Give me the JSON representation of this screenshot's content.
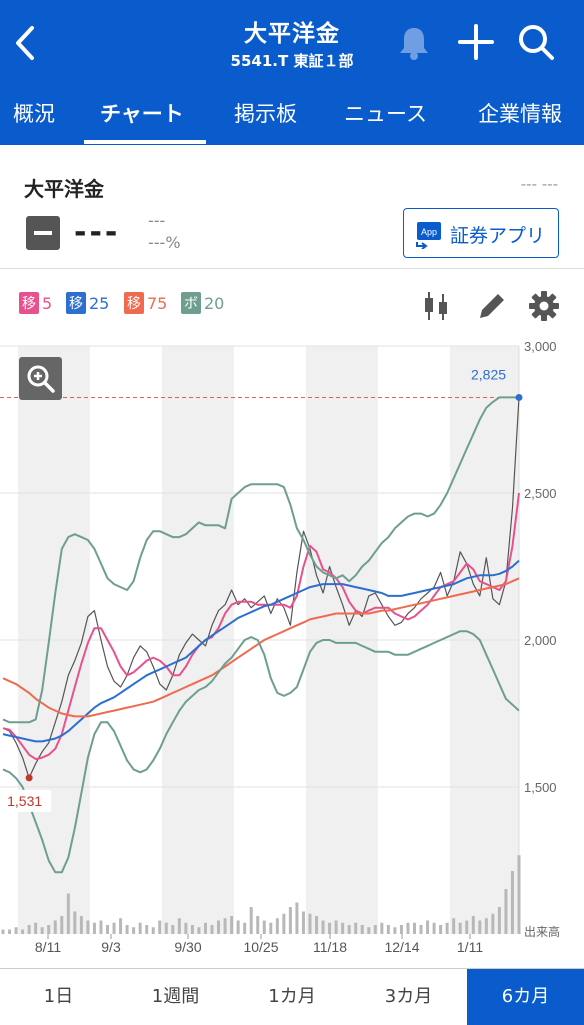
{
  "header": {
    "title": "大平洋金",
    "subtitle": "5541.T 東証１部",
    "tabs": [
      "概況",
      "チャート",
      "掲示板",
      "ニュース",
      "企業情報"
    ]
  },
  "stock": {
    "name": "大平洋金",
    "time": "--- ---",
    "price": "---",
    "change": "---",
    "change_pct": "---%",
    "app_button": "証券アプリ",
    "app_icon_text": "App"
  },
  "legend": [
    {
      "chip": "移",
      "value": "5",
      "color": "#e8508e"
    },
    {
      "chip": "移",
      "value": "25",
      "color": "#2c6fce"
    },
    {
      "chip": "移",
      "value": "75",
      "color": "#ef6a4e"
    },
    {
      "chip": "ボ",
      "value": "20",
      "color": "#6e9e90"
    }
  ],
  "chart_data": {
    "type": "line",
    "x_tick_labels": [
      "8/11",
      "9/3",
      "9/30",
      "10/25",
      "11/18",
      "12/14",
      "1/11"
    ],
    "y_tick_labels": [
      "3,000",
      "2,500",
      "2,000",
      "1,500"
    ],
    "ylim": [
      1000,
      3000
    ],
    "volume_label": "出来高",
    "annotations": {
      "high": "2,825",
      "low": "1,531"
    },
    "series": [
      {
        "values": [
          1700,
          1690,
          1650,
          1600,
          1531,
          1580,
          1620,
          1650,
          1720,
          1790,
          1880,
          1930,
          1990,
          2080,
          2100,
          2000,
          1910,
          1860,
          1840,
          1880,
          1940,
          1980,
          1960,
          1910,
          1850,
          1830,
          1880,
          1950,
          1990,
          2020,
          2000,
          1980,
          2050,
          2100,
          2120,
          2170,
          2120,
          2140,
          2110,
          2130,
          2150,
          2090,
          2140,
          2110,
          2050,
          2230,
          2370,
          2310,
          2220,
          2160,
          2250,
          2180,
          2120,
          2050,
          2100,
          2080,
          2150,
          2160,
          2120,
          2080,
          2050,
          2060,
          2090,
          2110,
          2140,
          2160,
          2180,
          2230,
          2150,
          2200,
          2300,
          2260,
          2190,
          2150,
          2280,
          2140,
          2120,
          2200,
          2450,
          2825
        ]
      },
      {
        "name": "5",
        "values": [
          1700,
          1695,
          1670,
          1640,
          1610,
          1595,
          1600,
          1610,
          1630,
          1680,
          1760,
          1840,
          1920,
          1990,
          2040,
          2040,
          2000,
          1960,
          1910,
          1880,
          1890,
          1910,
          1930,
          1940,
          1930,
          1910,
          1880,
          1880,
          1910,
          1950,
          1980,
          2000,
          2010,
          2040,
          2090,
          2120,
          2130,
          2130,
          2130,
          2120,
          2120,
          2120,
          2120,
          2120,
          2110,
          2150,
          2250,
          2320,
          2300,
          2240,
          2230,
          2210,
          2180,
          2130,
          2100,
          2090,
          2100,
          2110,
          2110,
          2110,
          2090,
          2080,
          2070,
          2080,
          2100,
          2120,
          2150,
          2180,
          2190,
          2200,
          2230,
          2260,
          2240,
          2200,
          2190,
          2180,
          2170,
          2200,
          2320,
          2500
        ]
      },
      {
        "name": "25",
        "values": [
          1680,
          1675,
          1670,
          1665,
          1660,
          1655,
          1655,
          1660,
          1665,
          1675,
          1690,
          1710,
          1730,
          1750,
          1770,
          1785,
          1795,
          1805,
          1820,
          1835,
          1850,
          1865,
          1880,
          1890,
          1900,
          1910,
          1920,
          1930,
          1940,
          1960,
          1980,
          2000,
          2015,
          2030,
          2045,
          2060,
          2075,
          2085,
          2095,
          2105,
          2115,
          2120,
          2130,
          2140,
          2150,
          2160,
          2170,
          2180,
          2185,
          2190,
          2190,
          2190,
          2190,
          2185,
          2180,
          2175,
          2170,
          2165,
          2160,
          2150,
          2150,
          2150,
          2155,
          2160,
          2165,
          2170,
          2175,
          2180,
          2185,
          2190,
          2200,
          2210,
          2215,
          2220,
          2220,
          2220,
          2225,
          2235,
          2250,
          2270
        ]
      },
      {
        "name": "75",
        "values": [
          1870,
          1860,
          1850,
          1835,
          1820,
          1800,
          1785,
          1770,
          1760,
          1750,
          1745,
          1740,
          1740,
          1740,
          1745,
          1750,
          1755,
          1760,
          1765,
          1770,
          1775,
          1780,
          1785,
          1790,
          1800,
          1810,
          1820,
          1830,
          1840,
          1850,
          1860,
          1870,
          1880,
          1895,
          1910,
          1925,
          1940,
          1955,
          1970,
          1985,
          2000,
          2010,
          2020,
          2030,
          2040,
          2050,
          2060,
          2070,
          2075,
          2080,
          2085,
          2090,
          2090,
          2090,
          2090,
          2090,
          2090,
          2095,
          2100,
          2100,
          2105,
          2110,
          2115,
          2120,
          2125,
          2130,
          2135,
          2140,
          2145,
          2150,
          2155,
          2160,
          2165,
          2170,
          2175,
          2180,
          2185,
          2190,
          2200,
          2210
        ]
      },
      {
        "name": "20",
        "values": [
          1730,
          1720,
          1720,
          1720,
          1720,
          1730,
          1830,
          1990,
          2160,
          2310,
          2350,
          2360,
          2350,
          2340,
          2310,
          2260,
          2210,
          2190,
          2180,
          2170,
          2200,
          2280,
          2340,
          2370,
          2370,
          2360,
          2350,
          2350,
          2360,
          2380,
          2400,
          2390,
          2390,
          2390,
          2380,
          2480,
          2500,
          2520,
          2530,
          2530,
          2530,
          2530,
          2530,
          2520,
          2460,
          2380,
          2340,
          2290,
          2250,
          2230,
          2220,
          2210,
          2220,
          2200,
          2220,
          2250,
          2270,
          2300,
          2330,
          2350,
          2380,
          2400,
          2420,
          2430,
          2430,
          2420,
          2430,
          2460,
          2500,
          2550,
          2600,
          2650,
          2700,
          2750,
          2790,
          2810,
          2825,
          2825,
          2825,
          2825
        ]
      },
      {
        "name": "20",
        "values": [
          1560,
          1550,
          1530,
          1500,
          1440,
          1380,
          1320,
          1250,
          1210,
          1210,
          1260,
          1360,
          1480,
          1600,
          1680,
          1720,
          1720,
          1690,
          1640,
          1590,
          1560,
          1550,
          1560,
          1590,
          1630,
          1680,
          1720,
          1760,
          1790,
          1810,
          1830,
          1840,
          1860,
          1890,
          1920,
          1940,
          1970,
          2000,
          2010,
          2000,
          1950,
          1870,
          1820,
          1810,
          1820,
          1840,
          1900,
          1960,
          1990,
          2000,
          2000,
          1990,
          1990,
          1990,
          1990,
          1980,
          1970,
          1960,
          1960,
          1960,
          1950,
          1950,
          1950,
          1960,
          1970,
          1980,
          1990,
          2000,
          2010,
          2020,
          2030,
          2030,
          2020,
          2000,
          1950,
          1900,
          1850,
          1800,
          1780,
          1760
        ]
      }
    ],
    "volume": [
      2,
      2,
      3,
      2,
      4,
      5,
      3,
      4,
      6,
      8,
      18,
      10,
      8,
      6,
      5,
      6,
      4,
      5,
      7,
      4,
      3,
      5,
      4,
      3,
      6,
      5,
      4,
      7,
      5,
      4,
      3,
      5,
      4,
      6,
      7,
      8,
      6,
      5,
      12,
      8,
      6,
      5,
      7,
      9,
      12,
      14,
      10,
      9,
      8,
      6,
      5,
      6,
      5,
      4,
      5,
      4,
      3,
      4,
      5,
      4,
      3,
      4,
      5,
      5,
      4,
      6,
      5,
      4,
      5,
      7,
      5,
      6,
      8,
      6,
      7,
      9,
      12,
      20,
      28,
      35
    ]
  },
  "periods": [
    "1日",
    "1週間",
    "1カ月",
    "3カ月",
    "6カ月"
  ],
  "active_period": 4
}
